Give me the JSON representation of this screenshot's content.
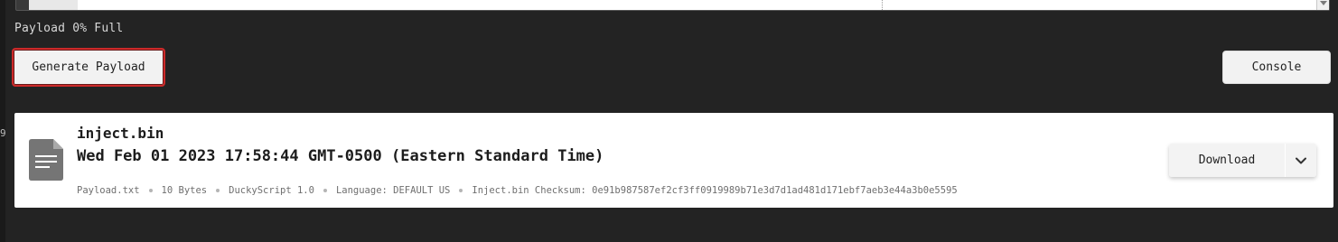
{
  "status": {
    "payload_fill": "Payload 0% Full"
  },
  "actions": {
    "generate_label": "Generate Payload",
    "console_label": "Console"
  },
  "left_edge_glyph": "9",
  "file": {
    "name": "inject.bin",
    "date": "Wed Feb 01 2023 17:58:44 GMT-0500 (Eastern Standard Time)",
    "meta": {
      "source": "Payload.txt",
      "size": "10 Bytes",
      "language_version": "DuckyScript 1.0",
      "keyboard_language": "Language: DEFAULT US",
      "checksum": "Inject.bin Checksum: 0e91b987587ef2cf3ff0919989b71e3d7d1ad481d171ebf7aeb3e44a3b0e5595"
    },
    "download_label": "Download",
    "icon": "document-icon",
    "menu_icon": "chevron-down-icon"
  },
  "colors": {
    "background": "#232323",
    "card": "#ffffff",
    "button": "#f2f2f2",
    "focus_border": "#cc2a2a"
  }
}
